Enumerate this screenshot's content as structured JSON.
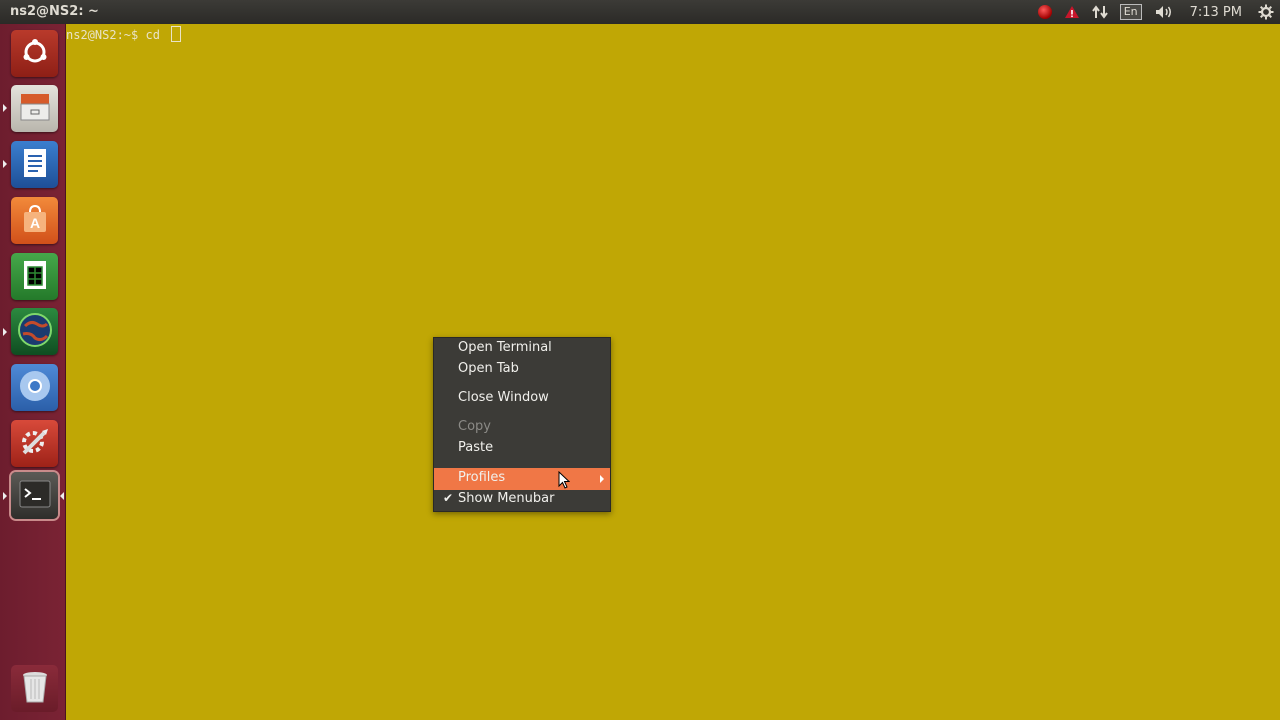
{
  "top_panel": {
    "window_title": "ns2@NS2: ~",
    "language": "En",
    "clock": "7:13 PM"
  },
  "launcher": {
    "items": [
      {
        "name": "ubuntu-dash",
        "icon": "ubuntu-logo-icon"
      },
      {
        "name": "files",
        "icon": "file-cabinet-icon"
      },
      {
        "name": "libreoffice-writer",
        "icon": "writer-document-icon"
      },
      {
        "name": "ubuntu-software-center",
        "icon": "software-bag-icon"
      },
      {
        "name": "libreoffice-calc",
        "icon": "spreadsheet-icon"
      },
      {
        "name": "globe-app",
        "icon": "globe-icon"
      },
      {
        "name": "chromium",
        "icon": "chromium-icon"
      },
      {
        "name": "system-settings",
        "icon": "settings-tools-icon"
      },
      {
        "name": "terminal",
        "icon": "terminal-icon"
      },
      {
        "name": "trash",
        "icon": "trash-icon"
      }
    ]
  },
  "terminal": {
    "prompt": "ns2@NS2:~$ cd "
  },
  "context_menu": {
    "open_terminal": "Open Terminal",
    "open_tab": "Open Tab",
    "close_window": "Close Window",
    "copy": "Copy",
    "paste": "Paste",
    "profiles": "Profiles",
    "show_menubar": "Show Menubar",
    "show_menubar_checked": true
  },
  "colors": {
    "terminal_background": "#c0a705",
    "menu_background": "#3c3b37",
    "menu_highlight": "#f07746",
    "launcher_background": "#7a2334"
  }
}
